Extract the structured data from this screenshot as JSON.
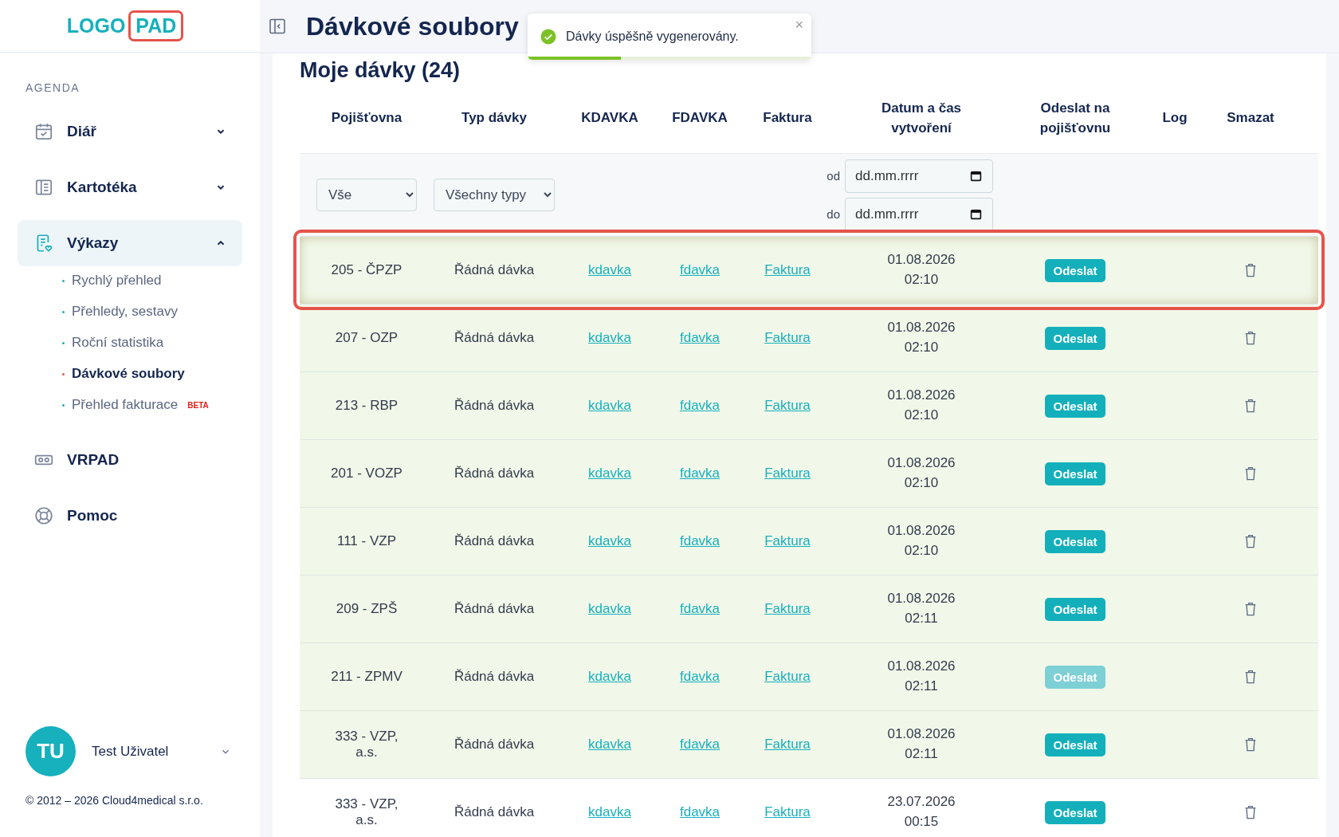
{
  "logo": {
    "text": "LOGO",
    "badge": "PAD"
  },
  "sidebar": {
    "section": "AGENDA",
    "items": [
      {
        "label": "Diář",
        "selected": false,
        "expanded": false
      },
      {
        "label": "Kartotéka",
        "selected": false,
        "expanded": false
      },
      {
        "label": "Výkazy",
        "selected": true,
        "expanded": true,
        "children": [
          {
            "label": "Rychlý přehled",
            "selected": false
          },
          {
            "label": "Přehledy, sestavy",
            "selected": false
          },
          {
            "label": "Roční statistika",
            "selected": false
          },
          {
            "label": "Dávkové soubory",
            "selected": true
          },
          {
            "label": "Přehled fakturace",
            "selected": false,
            "badge": "BETA"
          }
        ]
      },
      {
        "label": "VRPAD",
        "selected": false
      },
      {
        "label": "Pomoc",
        "selected": false
      }
    ],
    "user": {
      "initials": "TU",
      "name": "Test Uživatel"
    },
    "copyright": "© 2012 – 2026 Cloud4medical s.r.o."
  },
  "page_title": "Dávkové soubory",
  "toast": {
    "message": "Dávky úspěšně vygenerovány.",
    "close": "×",
    "level": 0.33
  },
  "section_title": "Moje dávky (24)",
  "table": {
    "columns": [
      "Pojišťovna",
      "Typ dávky",
      "KDAVKA",
      "FDAVKA",
      "Faktura",
      "Datum a čas vytvoření",
      "Odeslat na pojišťovnu",
      "Log",
      "Smazat"
    ],
    "filters": {
      "insurer": "Vše",
      "type": "Všechny typy",
      "from_label": "od",
      "from_placeholder": "dd.mm.rrrr",
      "to_label": "do",
      "to_placeholder": "dd.mm.rrrr"
    },
    "rows": [
      {
        "insurer": "205 - ČPZP",
        "type": "Řádná dávka",
        "kdavka": "kdavka",
        "fdavka": "fdavka",
        "invoice": "Faktura",
        "date": "01.08.2026",
        "time": "02:10",
        "send": "Odeslat",
        "send_disabled": false,
        "highlighted": true,
        "selected": true
      },
      {
        "insurer": "207 - OZP",
        "type": "Řádná dávka",
        "kdavka": "kdavka",
        "fdavka": "fdavka",
        "invoice": "Faktura",
        "date": "01.08.2026",
        "time": "02:10",
        "send": "Odeslat",
        "send_disabled": false,
        "highlighted": true,
        "selected": false
      },
      {
        "insurer": "213 - RBP",
        "type": "Řádná dávka",
        "kdavka": "kdavka",
        "fdavka": "fdavka",
        "invoice": "Faktura",
        "date": "01.08.2026",
        "time": "02:10",
        "send": "Odeslat",
        "send_disabled": false,
        "highlighted": true,
        "selected": false
      },
      {
        "insurer": "201 - VOZP",
        "type": "Řádná dávka",
        "kdavka": "kdavka",
        "fdavka": "fdavka",
        "invoice": "Faktura",
        "date": "01.08.2026",
        "time": "02:10",
        "send": "Odeslat",
        "send_disabled": false,
        "highlighted": true,
        "selected": false
      },
      {
        "insurer": "111 - VZP",
        "type": "Řádná dávka",
        "kdavka": "kdavka",
        "fdavka": "fdavka",
        "invoice": "Faktura",
        "date": "01.08.2026",
        "time": "02:10",
        "send": "Odeslat",
        "send_disabled": false,
        "highlighted": true,
        "selected": false
      },
      {
        "insurer": "209 - ZPŠ",
        "type": "Řádná dávka",
        "kdavka": "kdavka",
        "fdavka": "fdavka",
        "invoice": "Faktura",
        "date": "01.08.2026",
        "time": "02:11",
        "send": "Odeslat",
        "send_disabled": false,
        "highlighted": true,
        "selected": false
      },
      {
        "insurer": "211 - ZPMV",
        "type": "Řádná dávka",
        "kdavka": "kdavka",
        "fdavka": "fdavka",
        "invoice": "Faktura",
        "date": "01.08.2026",
        "time": "02:11",
        "send": "Odeslat",
        "send_disabled": true,
        "highlighted": true,
        "selected": false
      },
      {
        "insurer": "333 - VZP, a.s.",
        "type": "Řádná dávka",
        "kdavka": "kdavka",
        "fdavka": "fdavka",
        "invoice": "Faktura",
        "date": "01.08.2026",
        "time": "02:11",
        "send": "Odeslat",
        "send_disabled": false,
        "highlighted": true,
        "selected": false
      },
      {
        "insurer": "333 - VZP, a.s.",
        "type": "Řádná dávka",
        "kdavka": "kdavka",
        "fdavka": "fdavka",
        "invoice": "Faktura",
        "date": "23.07.2026",
        "time": "00:15",
        "send": "Odeslat",
        "send_disabled": false,
        "highlighted": false,
        "selected": false
      }
    ]
  }
}
